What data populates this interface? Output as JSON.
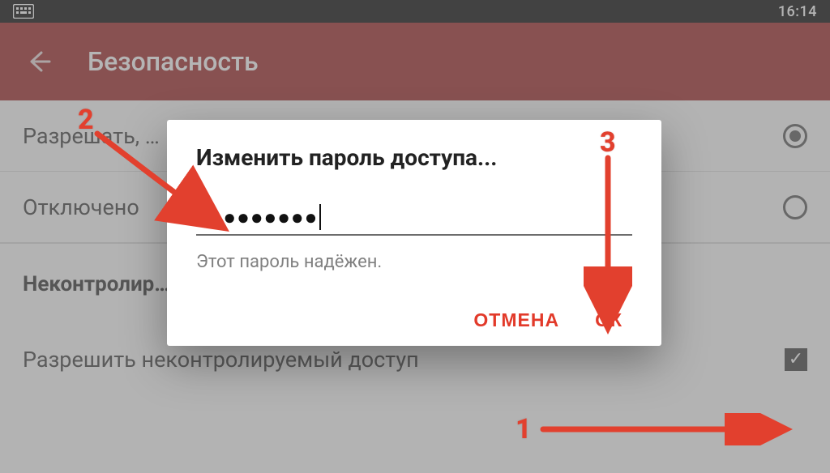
{
  "status": {
    "time": "16:14"
  },
  "header": {
    "title": "Безопасность"
  },
  "settings": {
    "optAllow": "Разрешать, …",
    "optOff": "Отключено",
    "sectionUncontrolled": "Неконтролир…",
    "optAllowUncontrolled": "Разрешить неконтролируемый доступ"
  },
  "dialog": {
    "title": "Изменить пароль доступа...",
    "passwordMasked": "●●●●●●●●●",
    "hint": "Этот пароль надёжен.",
    "cancel": "ОТМЕНА",
    "ok": "ОК"
  },
  "anno": {
    "n1": "1",
    "n2": "2",
    "n3": "3"
  },
  "colors": {
    "accent": "#e23a2a",
    "headerBg": "#9c2222"
  }
}
